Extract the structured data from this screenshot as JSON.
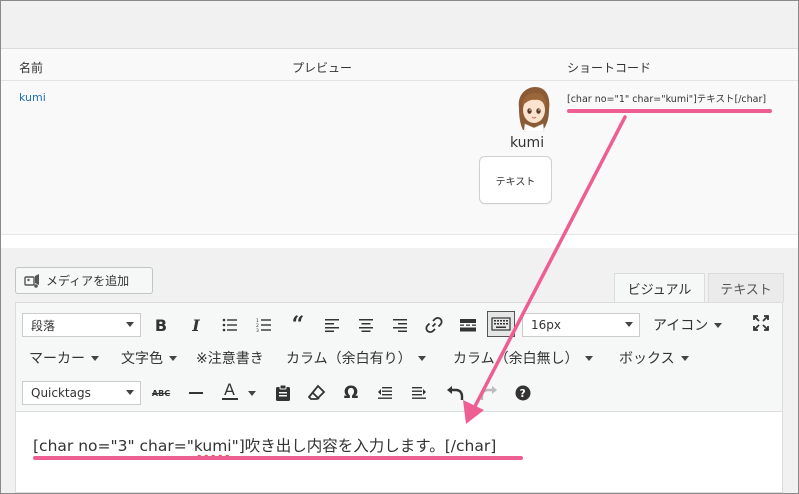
{
  "table": {
    "columns": {
      "name": "名前",
      "preview": "プレビュー",
      "shortcode": "ショートコード"
    },
    "rows": [
      {
        "name": "kumi",
        "preview_name": "kumi",
        "preview_bubble": "テキスト",
        "shortcode": "[char no=\"1\" char=\"kumi\"]テキスト[/char]"
      }
    ]
  },
  "editor": {
    "add_media_label": "メディアを追加",
    "tabs": {
      "visual": "ビジュアル",
      "text": "テキスト"
    },
    "toolbar": {
      "format_select": "段落",
      "font_size_select": "16px",
      "icon_menu": "アイコン",
      "marker_menu": "マーカー",
      "text_color_menu": "文字色",
      "note_label": "※注意書き",
      "column_margin_menu": "カラム（余白有り）",
      "column_nomargin_menu": "カラム（余白無し）",
      "box_menu": "ボックス",
      "quicktags_select": "Quicktags",
      "icons": [
        "bold-icon",
        "italic-icon",
        "bullet-list-icon",
        "numbered-list-icon",
        "blockquote-icon",
        "align-left-icon",
        "align-center-icon",
        "align-right-icon",
        "link-icon",
        "read-more-icon",
        "toolbar-toggle-icon",
        "fullscreen-icon",
        "strikethrough-icon",
        "horizontal-line-icon",
        "text-color-icon",
        "paste-text-icon",
        "clear-formatting-icon",
        "special-character-icon",
        "outdent-icon",
        "indent-icon",
        "undo-icon",
        "redo-icon",
        "help-icon"
      ]
    },
    "content": {
      "before": "[char no=\"3\" char=\"",
      "highlight": "kumi",
      "after": "\"]吹き出し内容を入力します。[/char]"
    }
  },
  "colors": {
    "annotation": "#ee5e92",
    "link": "#2271b1",
    "spellcheck": "#e0464a"
  }
}
